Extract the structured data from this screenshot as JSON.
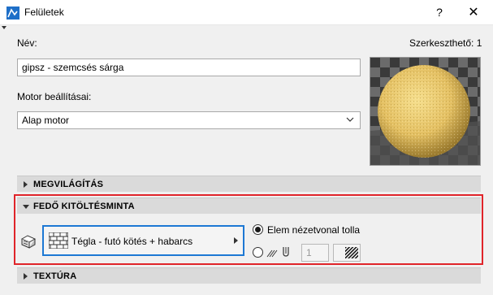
{
  "window": {
    "title": "Felületek",
    "help_symbol": "?",
    "close_symbol": "✕"
  },
  "header": {
    "name_label": "Név:",
    "editable_label": "Szerkeszthető: 1"
  },
  "name_field": {
    "value": "gipsz - szemcsés sárga"
  },
  "engine": {
    "label": "Motor beállításai:",
    "selected": "Alap motor"
  },
  "preview": {
    "sphere_color": "#e6c46a"
  },
  "sections": {
    "lighting": "MEGVILÁGÍTÁS",
    "fill": "FEDŐ KITÖLTÉSMINTA",
    "texture": "TEXTÚRA"
  },
  "fill_pattern": {
    "value": "Tégla - futó kötés + habarcs",
    "option_elem_pen": "Elem nézetvonal tolla",
    "pen_number": "1"
  },
  "colors": {
    "highlight": "#e0242a",
    "focus_border": "#1d78d4"
  }
}
